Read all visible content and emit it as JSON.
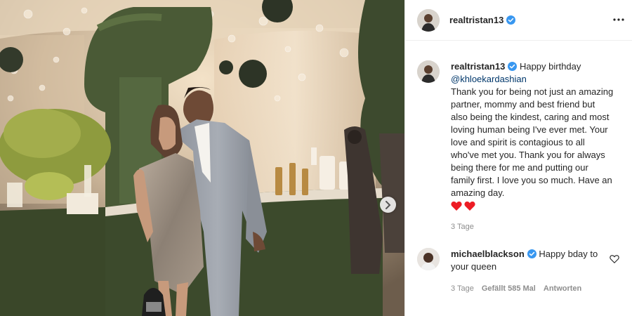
{
  "header": {
    "username": "realtristan13",
    "verified_icon": "verified-badge-icon",
    "more_icon": "more-options-icon"
  },
  "post": {
    "caption_username": "realtristan13",
    "caption_greeting": "Happy birthday",
    "caption_mention": "@khloekardashian",
    "caption_text": "Thank you for being not just an amazing partner, mommy and best friend but also being the kindest, caring and most loving human being I've ever met. Your love and spirit is contagious to all who've met you. Thank you for always being there for me and putting our family first. I love you so much. Have an amazing day.",
    "caption_emojis": [
      "❤️",
      "❤️"
    ],
    "timestamp": "3 Tage"
  },
  "comment": {
    "username": "michaelblackson",
    "text": "Happy bday to your queen",
    "timestamp": "3 Tage",
    "likes": "Gefällt 585 Mal",
    "reply_label": "Antworten"
  },
  "colors": {
    "verified": "#3897f0",
    "link": "#00376b",
    "secondary_text": "#8e8e8e",
    "heart": "#ed1c24"
  }
}
